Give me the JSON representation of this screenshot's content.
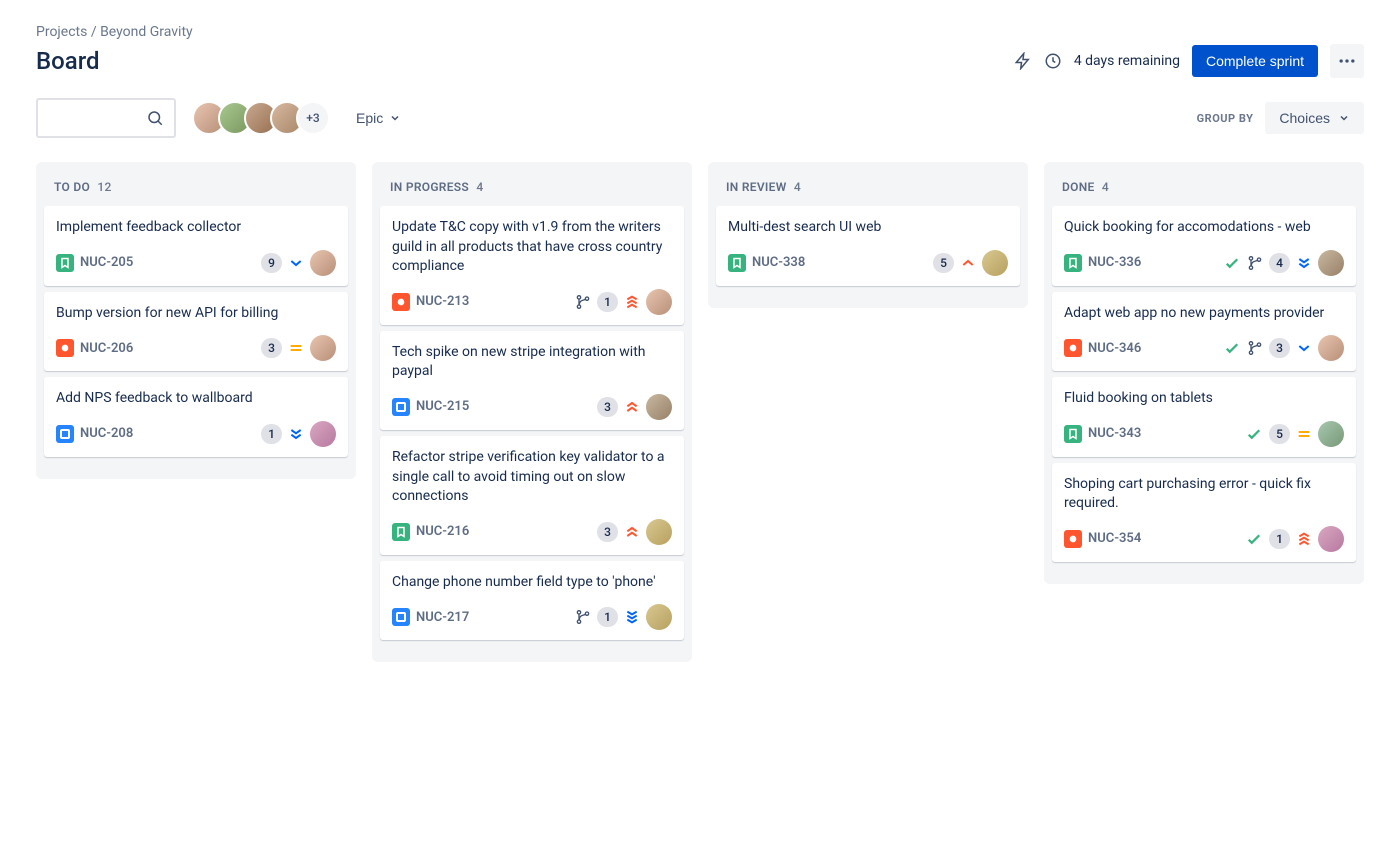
{
  "breadcrumb": {
    "root": "Projects",
    "project": "Beyond Gravity"
  },
  "page_title": "Board",
  "header": {
    "remaining": "4 days remaining",
    "complete_sprint": "Complete sprint"
  },
  "toolbar": {
    "avatar_overflow": "+3",
    "epic_filter": "Epic",
    "group_by_label": "GROUP BY",
    "group_by_value": "Choices"
  },
  "columns": [
    {
      "title": "TO DO",
      "count": 12,
      "cards": [
        {
          "title": "Implement feedback collector",
          "type": "story",
          "key": "NUC-205",
          "badge": 9,
          "priority": "low",
          "avatar": "c1"
        },
        {
          "title": "Bump version for new API for billing",
          "type": "bug",
          "key": "NUC-206",
          "badge": 3,
          "priority": "medium",
          "avatar": "c1"
        },
        {
          "title": "Add NPS feedback to wallboard",
          "type": "task",
          "key": "NUC-208",
          "badge": 1,
          "priority": "lowest",
          "avatar": "c3"
        }
      ]
    },
    {
      "title": "IN PROGRESS",
      "count": 4,
      "cards": [
        {
          "title": "Update T&C copy with v1.9 from the writers guild in all products that have cross country compliance",
          "type": "bug",
          "key": "NUC-213",
          "branch": true,
          "badge": 1,
          "priority": "highest",
          "avatar": "c1"
        },
        {
          "title": "Tech spike on new stripe integration with paypal",
          "type": "task",
          "key": "NUC-215",
          "badge": 3,
          "priority": "high",
          "avatar": "c2"
        },
        {
          "title": "Refactor stripe verification key validator to a single call to avoid timing out on slow connections",
          "type": "story",
          "key": "NUC-216",
          "badge": 3,
          "priority": "high",
          "avatar": "c5"
        },
        {
          "title": "Change phone number field type to 'phone'",
          "type": "task",
          "key": "NUC-217",
          "branch": true,
          "badge": 1,
          "priority": "lowest-blue",
          "avatar": "c5"
        }
      ]
    },
    {
      "title": "IN REVIEW",
      "count": 4,
      "cards": [
        {
          "title": "Multi-dest search UI web",
          "type": "story",
          "key": "NUC-338",
          "badge": 5,
          "priority": "high-single",
          "avatar": "c5"
        }
      ]
    },
    {
      "title": "DONE",
      "count": 4,
      "cards": [
        {
          "title": "Quick booking for accomodations - web",
          "type": "story",
          "key": "NUC-336",
          "done": true,
          "branch": true,
          "badge": 4,
          "priority": "lowest",
          "avatar": "c2"
        },
        {
          "title": "Adapt web app no new payments provider",
          "type": "bug",
          "key": "NUC-346",
          "done": true,
          "branch": true,
          "badge": 3,
          "priority": "low",
          "avatar": "c1"
        },
        {
          "title": "Fluid booking on tablets",
          "type": "story",
          "key": "NUC-343",
          "done": true,
          "badge": 5,
          "priority": "medium",
          "avatar": "c4"
        },
        {
          "title": "Shoping cart purchasing error - quick fix required.",
          "type": "bug",
          "key": "NUC-354",
          "done": true,
          "badge": 1,
          "priority": "highest",
          "avatar": "c3"
        }
      ]
    }
  ]
}
